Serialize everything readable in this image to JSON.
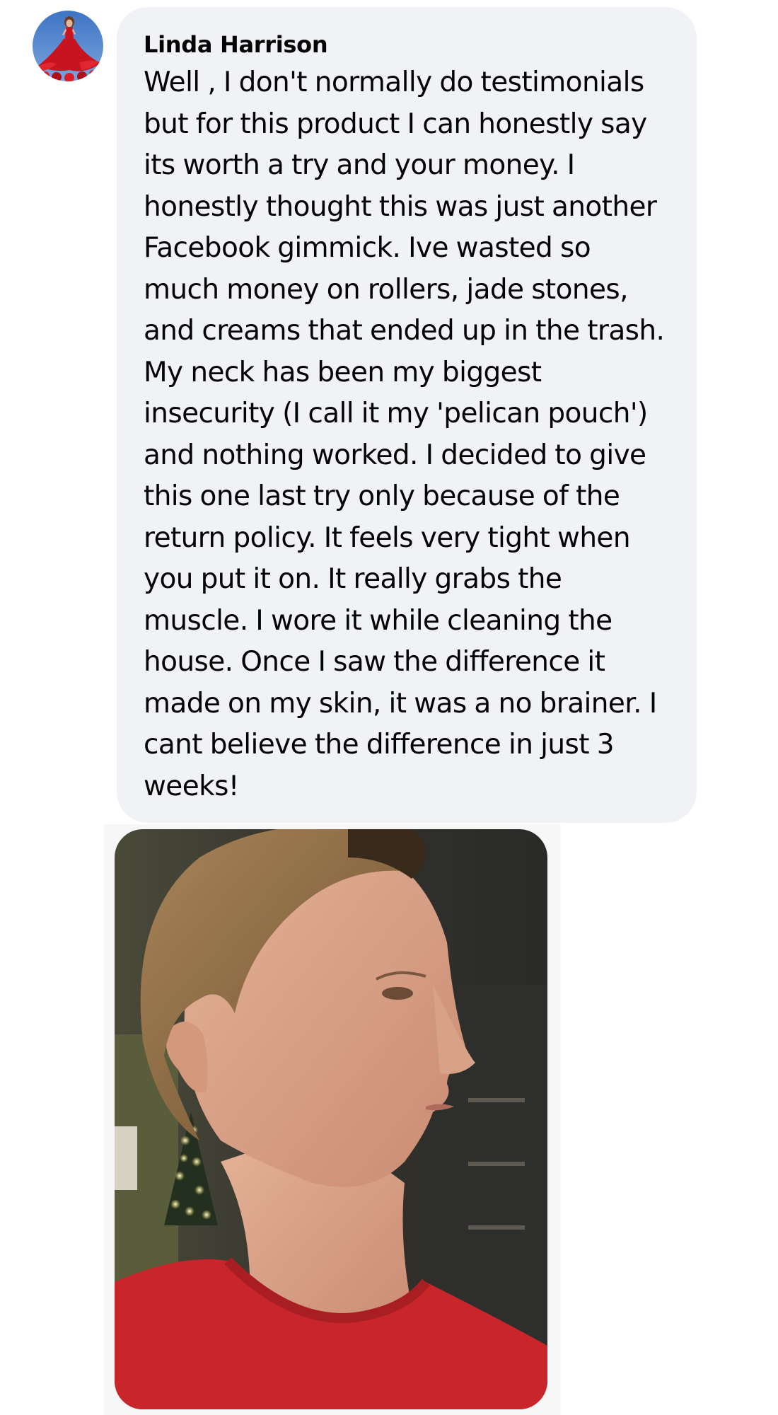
{
  "comment": {
    "author": "Linda Harrison",
    "text": "Well , I don't normally do testimonials but for this product I can honestly say its worth a try and your money. I honestly thought this was just another Facebook gimmick. Ive wasted so much money on rollers, jade stones, and creams that ended up in the trash. My neck has been my biggest insecurity (I call it my 'pelican pouch') and nothing worked. I decided to give this one last try only because of the return policy. It feels very tight when you put it on. It really grabs the muscle. I wore it while cleaning the house. Once I saw the difference it made on my skin, it was a no brainer. I cant believe the difference in just 3 weeks!"
  },
  "avatar": {
    "icon": "profile-photo-woman-red-dress",
    "colors": {
      "sky": "#4a7fc9",
      "dress": "#c8141e",
      "skin": "#e2b89a"
    }
  },
  "attachment": {
    "icon": "photo-woman-neck-profile",
    "colors": {
      "shirt": "#c8262a",
      "hair": "#8c6a45",
      "skin": "#d9a58a",
      "background": "#3b3a34"
    }
  },
  "colors": {
    "bubble": "#f0f2f5",
    "text": "#050505",
    "page": "#ffffff"
  }
}
